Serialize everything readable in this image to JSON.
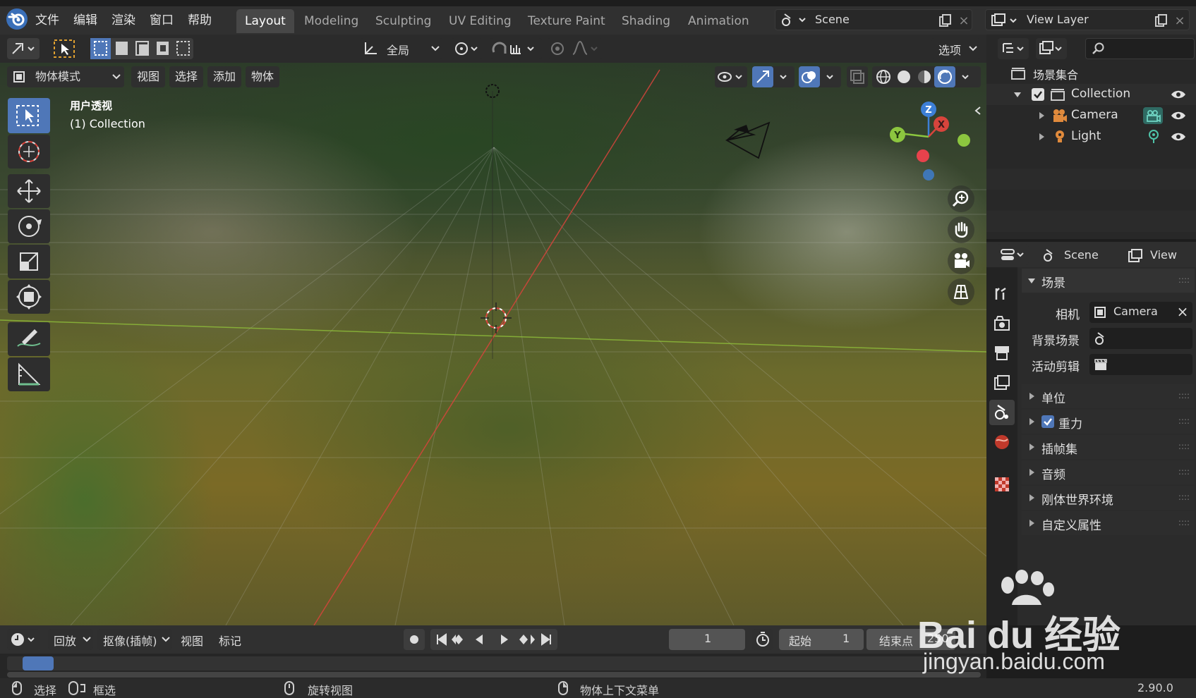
{
  "menu": [
    "文件",
    "编辑",
    "渲染",
    "窗口",
    "帮助"
  ],
  "workspaces": [
    "Layout",
    "Modeling",
    "Sculpting",
    "UV Editing",
    "Texture Paint",
    "Shading",
    "Animation"
  ],
  "scene_field": "Scene",
  "view_layer_field": "View Layer",
  "toolbar": {
    "transform_orientation": "全局",
    "options": "选项"
  },
  "viewport": {
    "mode": "物体模式",
    "menus": [
      "视图",
      "选择",
      "添加",
      "物体"
    ],
    "overlay_line1": "用户透视",
    "overlay_line2": "(1) Collection",
    "gizmo": {
      "z": "Z",
      "x": "X",
      "y": "Y"
    }
  },
  "outliner": {
    "scene_collection": "场景集合",
    "collection": "Collection",
    "camera": "Camera",
    "light": "Light"
  },
  "properties": {
    "scene_tab": "Scene",
    "view_tab": "View",
    "panel_title": "场景",
    "camera_label": "相机",
    "camera_value": "Camera",
    "background_scene_label": "背景场景",
    "active_clip_label": "活动剪辑",
    "sections": [
      "单位",
      "重力",
      "插帧集",
      "音频",
      "刚体世界环境",
      "自定义属性"
    ]
  },
  "timeline": {
    "playback": "回放",
    "keying": "抠像(插帧)",
    "view": "视图",
    "marker": "标记",
    "current_frame": "1",
    "start_label": "起始",
    "start_value": "1",
    "end_label": "结束点",
    "end_value": "250"
  },
  "status": {
    "select": "选择",
    "box_select": "框选",
    "rotate_view": "旋转视图",
    "context_menu": "物体上下文菜单",
    "version": "2.90.0"
  },
  "watermark": {
    "brand": "Bai du 经验",
    "url": "jingyan.baidu.com"
  }
}
